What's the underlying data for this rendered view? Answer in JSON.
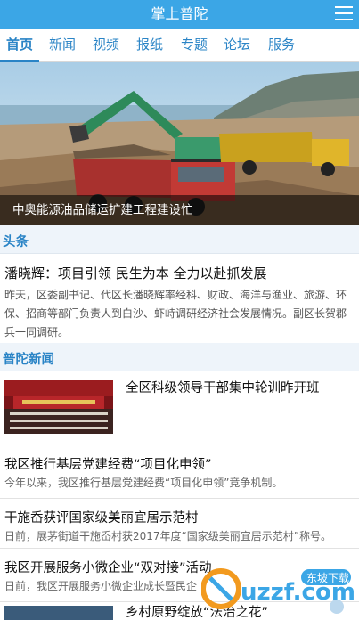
{
  "app": {
    "title": "掌上普陀"
  },
  "tabs": [
    "首页",
    "新闻",
    "视频",
    "报纸",
    "专题",
    "论坛",
    "服务"
  ],
  "hero": {
    "caption": "中奥能源油品储运扩建工程建设忙"
  },
  "section_headlines": {
    "label": "头条"
  },
  "headline": {
    "title": "潘晓辉：项目引领 民生为本 全力以赴抓发展",
    "summary": "昨天，区委副书记、代区长潘晓辉率经科、财政、海洋与渔业、旅游、环保、招商等部门负责人到白沙、虾峙调研经济社会发展情况。副区长贺郡兵一同调研。"
  },
  "section_news": {
    "label": "普陀新闻"
  },
  "news": [
    {
      "title": "全区科级领导干部集中轮训昨开班"
    },
    {
      "title": "我区推行基层党建经费“项目化申领”",
      "summary": "今年以来，我区推行基层党建经费“项目化申领”竞争机制。"
    },
    {
      "title": "干施岙获评国家级美丽宜居示范村",
      "summary": "日前，展茅街道干施岙村获2017年度“国家级美丽宜居示范村”称号。"
    },
    {
      "title": "我区开展服务小微企业“双对接”活动",
      "summary": "日前，我区开展服务小微企业成长暨民企"
    },
    {
      "title": "乡村原野绽放“法治之花”"
    }
  ],
  "watermark": {
    "text": "uzzf.com",
    "tag": "东坡下载"
  },
  "colors": {
    "accent": "#3ba6e6",
    "link": "#2a84c6"
  }
}
